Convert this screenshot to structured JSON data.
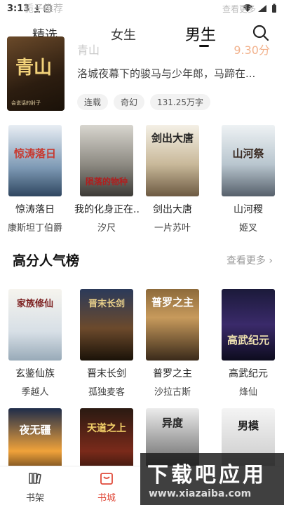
{
  "status_bar": {
    "time": "3:13"
  },
  "faded_header": {
    "title": "栀子推荐",
    "more": "查看更多"
  },
  "tabs": [
    {
      "label": "精选"
    },
    {
      "label": "女生"
    },
    {
      "label": "男生",
      "active": true
    }
  ],
  "featured": {
    "cover_title": "青山",
    "cover_sub": "会说话的肘子",
    "title": "青山",
    "score": "9.30分",
    "description": "洛城夜幕下的骏马与少年郎，马蹄在...",
    "tags": [
      "连载",
      "奇幻",
      "131.25万字"
    ]
  },
  "row1": [
    {
      "cover": "惊涛落日",
      "title": "惊涛落日",
      "author": "康斯坦丁伯爵"
    },
    {
      "cover": "陨落的物种",
      "title": "我的化身正在...",
      "author": "汐尺"
    },
    {
      "cover": "剑出大唐",
      "title": "剑出大唐",
      "author": "一片苏叶"
    },
    {
      "cover": "山河祭",
      "title": "山河稷",
      "author": "姬叉"
    }
  ],
  "section": {
    "title": "高分人气榜",
    "more": "查看更多"
  },
  "row2": [
    {
      "cover": "家族修仙",
      "title": "玄鉴仙族",
      "author": "季越人"
    },
    {
      "cover": "晋末长剑",
      "title": "晋末长剑",
      "author": "孤独麦客"
    },
    {
      "cover": "普罗之主",
      "title": "普罗之主",
      "author": "沙拉古斯"
    },
    {
      "cover": "高武纪元",
      "title": "高武纪元",
      "author": "烽仙"
    }
  ],
  "row3": [
    {
      "cover": "夜无疆"
    },
    {
      "cover": "天道之上"
    },
    {
      "cover": "异度"
    },
    {
      "cover": "男模"
    }
  ],
  "bottom_nav": [
    {
      "label": "书架"
    },
    {
      "label": "书城",
      "active": true
    }
  ],
  "watermark": {
    "main": "下载吧应用",
    "url": "www.xiazaiba.com"
  },
  "colors": {
    "accent": "#e04a3a",
    "score": "#f2b28d"
  }
}
